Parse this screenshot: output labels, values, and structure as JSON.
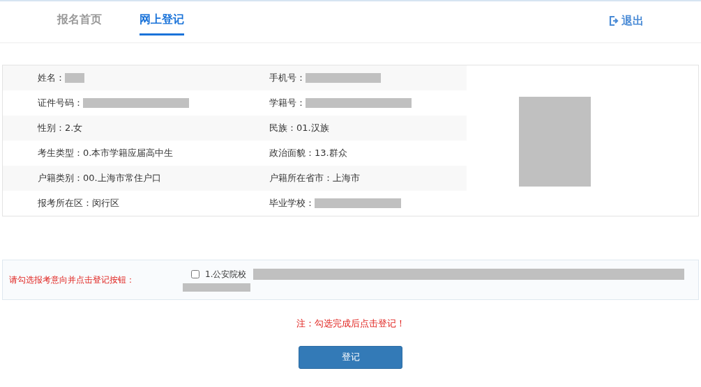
{
  "nav": {
    "tabs": [
      {
        "label": "报名首页",
        "selected": false
      },
      {
        "label": "网上登记",
        "selected": true
      }
    ],
    "logout": "退出"
  },
  "info": {
    "rows": [
      [
        {
          "label": "姓名：",
          "kind": "redacted"
        },
        {
          "label": "手机号：",
          "kind": "redacted"
        }
      ],
      [
        {
          "label": "证件号码：",
          "kind": "redacted"
        },
        {
          "label": "学籍号：",
          "kind": "redacted"
        }
      ],
      [
        {
          "label": "性别：",
          "kind": "text",
          "value": "2.女"
        },
        {
          "label": "民族：",
          "kind": "text",
          "value": "01.汉族"
        }
      ],
      [
        {
          "label": "考生类型：",
          "kind": "text",
          "value": "0.本市学籍应届高中生"
        },
        {
          "label": "政治面貌：",
          "kind": "text",
          "value": "13.群众"
        }
      ],
      [
        {
          "label": "户籍类别：",
          "kind": "text",
          "value": "00.上海市常住户口"
        },
        {
          "label": "户籍所在省市：",
          "kind": "text",
          "value": "上海市"
        }
      ],
      [
        {
          "label": "报考所在区：",
          "kind": "text",
          "value": "闵行区"
        },
        {
          "label": "毕业学校：",
          "kind": "redacted"
        }
      ]
    ],
    "photo": {
      "kind": "redacted"
    }
  },
  "choice": {
    "prompt": "请勾选报考意向并点击登记按钮：",
    "options": [
      {
        "label": "1.公安院校",
        "checked": false
      }
    ]
  },
  "note": "注：勾选完成后点击登记！",
  "submit": "登记"
}
